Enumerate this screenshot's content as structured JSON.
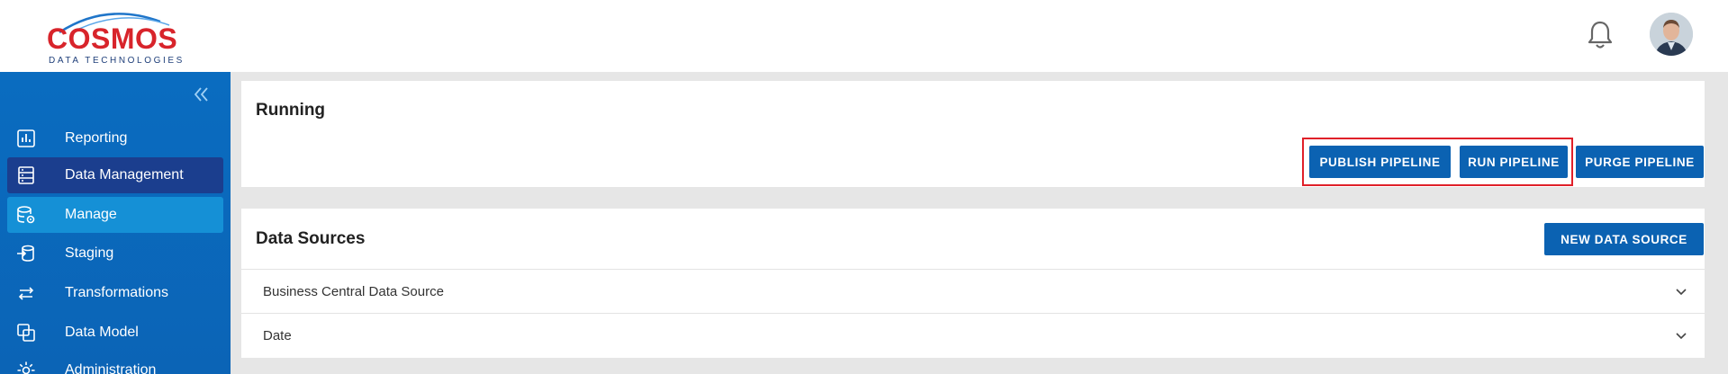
{
  "brand": {
    "name": "COSMOS",
    "tagline": "DATA TECHNOLOGIES",
    "primary_color": "#0b62b2",
    "logo_red": "#d8242b"
  },
  "header": {
    "notification_icon": "bell-icon",
    "avatar": "user-avatar"
  },
  "sidebar": {
    "collapse_icon": "double-chevron-left-icon",
    "items": [
      {
        "label": "Reporting",
        "icon": "chart-icon"
      },
      {
        "label": "Data Management",
        "icon": "server-icon"
      },
      {
        "label": "Manage",
        "icon": "database-gear-icon"
      },
      {
        "label": "Staging",
        "icon": "database-import-icon"
      },
      {
        "label": "Transformations",
        "icon": "swap-arrows-icon"
      },
      {
        "label": "Data Model",
        "icon": "layers-icon"
      },
      {
        "label": "Administration",
        "icon": "gear-icon"
      }
    ]
  },
  "running": {
    "title": "Running",
    "buttons": {
      "publish": "PUBLISH PIPELINE",
      "run": "RUN PIPELINE",
      "purge": "PURGE PIPELINE"
    }
  },
  "sources": {
    "title": "Data Sources",
    "new_button": "NEW DATA SOURCE",
    "rows": [
      {
        "label": "Business Central Data Source"
      },
      {
        "label": "Date"
      }
    ]
  }
}
